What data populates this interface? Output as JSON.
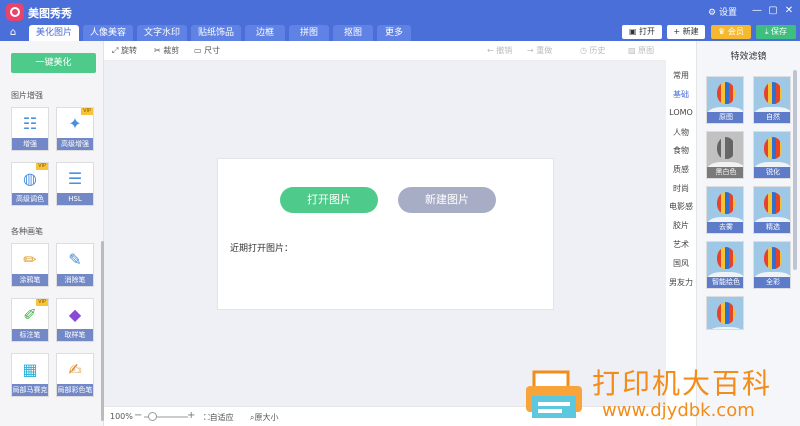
{
  "app": {
    "title": "美图秀秀",
    "settings": "设置",
    "win": [
      "—",
      "▢",
      "✕"
    ]
  },
  "tabs": [
    "美化图片",
    "人像美容",
    "文字水印",
    "贴纸饰品",
    "边框",
    "拼图",
    "抠图",
    "更多"
  ],
  "topright": {
    "open": "打开",
    "new": "新建",
    "vip": "会员",
    "save": "保存"
  },
  "toolbar": {
    "rotate": "旋转",
    "crop": "裁剪",
    "size": "尺寸",
    "undo": "撤销",
    "redo": "重做",
    "history": "历史",
    "original": "原图"
  },
  "left": {
    "onekey": "一键美化",
    "sect1": "图片增强",
    "tools1": [
      {
        "label": "增强",
        "icon": "☷"
      },
      {
        "label": "高级增强",
        "icon": "✦",
        "vip": "VIP"
      },
      {
        "label": "高级调色",
        "icon": "◍",
        "vip": "VIP"
      },
      {
        "label": "HSL",
        "icon": "☰"
      }
    ],
    "sect2": "各种画笔",
    "tools2": [
      {
        "label": "涂鸦笔",
        "icon": "✏"
      },
      {
        "label": "消除笔",
        "icon": "✎"
      },
      {
        "label": "标注笔",
        "icon": "✐",
        "vip": "VIP"
      },
      {
        "label": "取样笔",
        "icon": "◆"
      },
      {
        "label": "局部马赛克",
        "icon": "▦"
      },
      {
        "label": "局部彩色笔",
        "icon": "✍"
      }
    ]
  },
  "dialog": {
    "open": "打开图片",
    "new": "新建图片",
    "recent": "近期打开图片："
  },
  "bottom": {
    "zoom": "100%",
    "minus": "−",
    "plus": "+",
    "fit": "自适应",
    "actual": "原大小"
  },
  "categories": [
    "常用",
    "基础",
    "LOMO",
    "人物",
    "食物",
    "质感",
    "时尚",
    "电影感",
    "胶片",
    "艺术",
    "国风",
    "男友力"
  ],
  "filters": {
    "title": "特效滤镜",
    "items": [
      "原图",
      "自然",
      "黑白色",
      "锐化",
      "去雾",
      "精选",
      "智能绘色",
      "全彩",
      ""
    ]
  },
  "watermark": {
    "cn": "打印机大百科",
    "url": "www.djydbk.com"
  }
}
